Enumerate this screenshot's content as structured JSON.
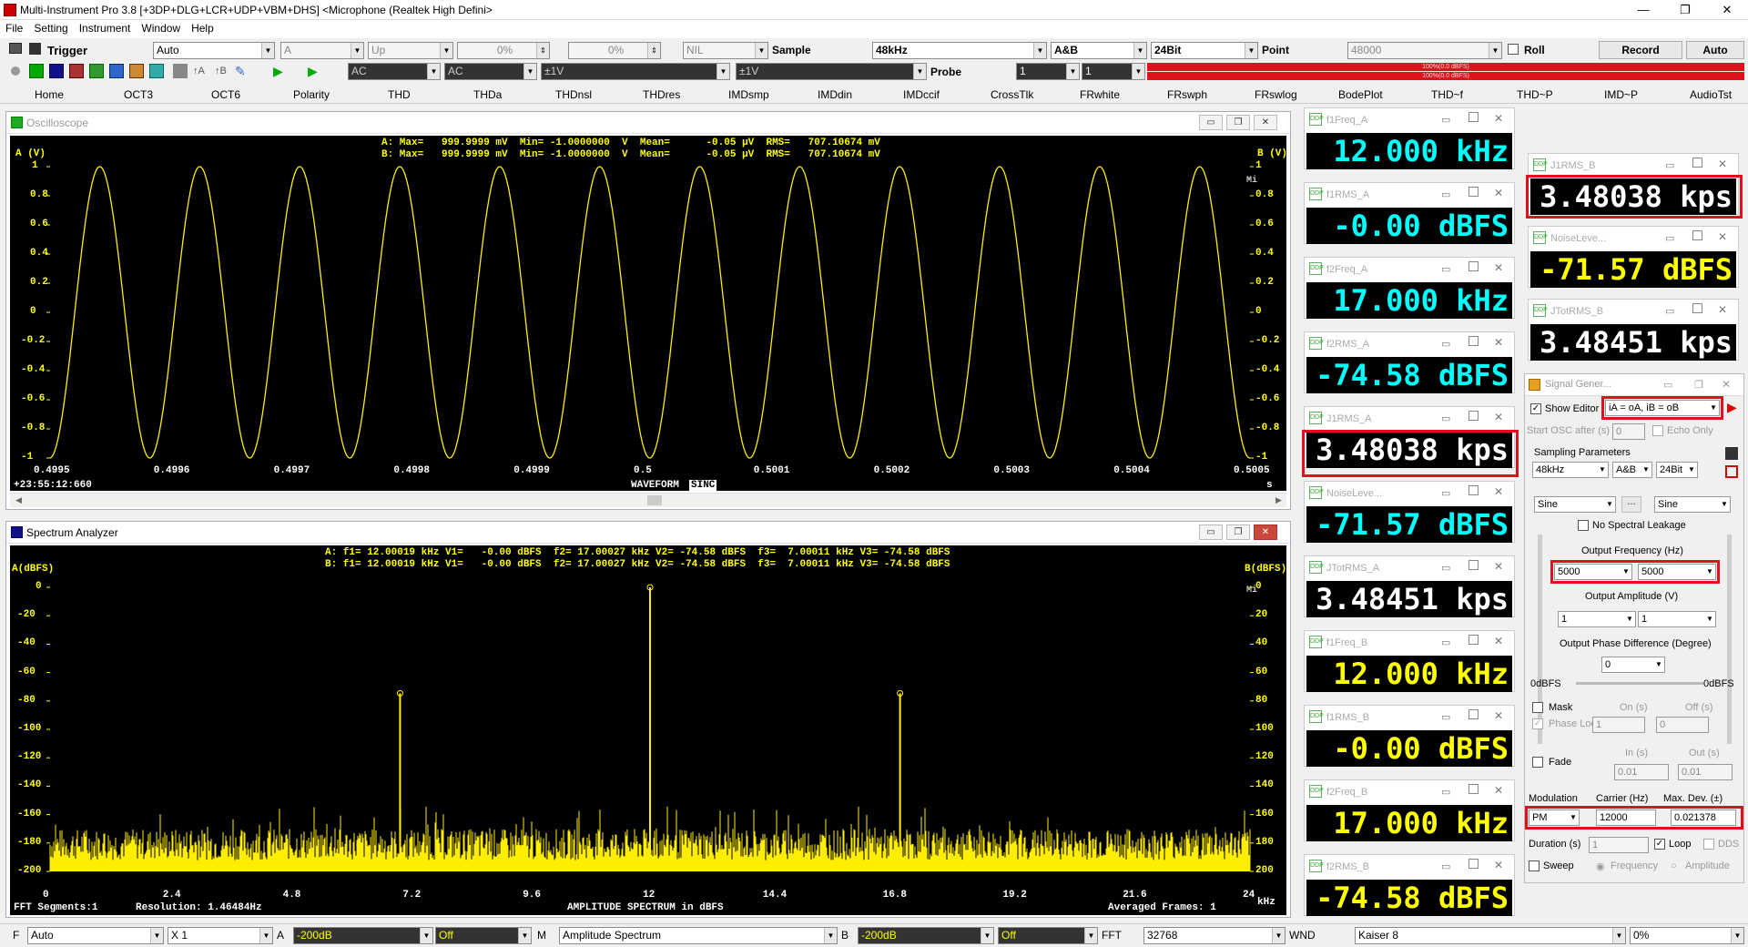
{
  "window": {
    "title": "Multi-Instrument Pro 3.8    [+3DP+DLG+LCR+UDP+VBM+DHS]    <Microphone (Realtek High Defini>",
    "minimize": "—",
    "maximize": "❐",
    "close": "✕"
  },
  "menu": [
    "File",
    "Setting",
    "Instrument",
    "Window",
    "Help"
  ],
  "toolbar1": {
    "trigger_label": "Trigger",
    "trigger_mode": "Auto",
    "channel": "A",
    "slope": "Up",
    "level1": "0%",
    "level2": "0%",
    "nil": "NIL",
    "sample_label": "Sample",
    "sample_rate": "48kHz",
    "channels": "A&B",
    "bits": "24Bit",
    "point_label": "Point",
    "points": "48000",
    "roll_label": "Roll",
    "record_label": "Record",
    "auto_label": "Auto"
  },
  "toolbar2": {
    "coupling_a": "AC",
    "coupling_b": "AC",
    "range_a": "±1V",
    "range_b": "±1V",
    "probe_label": "Probe",
    "probe_a": "1",
    "probe_b": "1",
    "level_meter_text": "100%(0.0 dBFS)"
  },
  "tabs": [
    "Home",
    "OCT3",
    "OCT6",
    "Polarity",
    "THD",
    "THDa",
    "THDnsl",
    "THDres",
    "IMDsmp",
    "IMDdin",
    "IMDccif",
    "CrossTlk",
    "FRwhite",
    "FRswph",
    "FRswlog",
    "BodePlot",
    "THD~f",
    "THD~P",
    "IMD~P",
    "AudioTst"
  ],
  "oscilloscope": {
    "title": "Oscilloscope",
    "info_a": "A: Max=   999.9999 mV  Min= -1.0000000  V  Mean=      -0.05 µV  RMS=   707.10674 mV",
    "info_b": "B: Max=   999.9999 mV  Min= -1.0000000  V  Mean=      -0.05 µV  RMS=   707.10674 mV",
    "ylabel_a": "A (V)",
    "ylabel_b": "B (V)",
    "yticks_left": [
      "1",
      "0.8",
      "0.6",
      "0.4",
      "0.2",
      "0",
      "-0.2",
      "-0.4",
      "-0.6",
      "-0.8",
      "-1"
    ],
    "yticks_right": [
      "1",
      "0.8",
      "0.6",
      "0.4",
      "0.2",
      "0",
      "-0.2",
      "-0.4",
      "-0.6",
      "-0.8",
      "-1"
    ],
    "xticks": [
      "0.4995",
      "0.4996",
      "0.4997",
      "0.4998",
      "0.4999",
      "0.5",
      "0.5001",
      "0.5002",
      "0.5003",
      "0.5004",
      "0.5005"
    ],
    "xunit": "s",
    "timestamp": "+23:55:12:660",
    "footer": "WAVEFORM",
    "footer2": "SINC",
    "badge": "Mi"
  },
  "spectrum": {
    "title": "Spectrum Analyzer",
    "info_a": "A: f1= 12.00019 kHz V1=   -0.00 dBFS  f2= 17.00027 kHz V2= -74.58 dBFS  f3=  7.00011 kHz V3= -74.58 dBFS",
    "info_b": "B: f1= 12.00019 kHz V1=   -0.00 dBFS  f2= 17.00027 kHz V2= -74.58 dBFS  f3=  7.00011 kHz V3= -74.58 dBFS",
    "ylabel_a": "A(dBFS)",
    "ylabel_b": "B(dBFS)",
    "yticks_left": [
      "0",
      "-20",
      "-40",
      "-60",
      "-80",
      "-100",
      "-120",
      "-140",
      "-160",
      "-180",
      "-200"
    ],
    "yticks_right": [
      "0",
      "20",
      "40",
      "60",
      "80",
      "100",
      "120",
      "140",
      "160",
      "180",
      "200"
    ],
    "xticks": [
      "0",
      "2.4",
      "4.8",
      "7.2",
      "9.6",
      "12",
      "14.4",
      "16.8",
      "19.2",
      "21.6",
      "24"
    ],
    "xunit": "kHz",
    "fft_segments": "FFT Segments:1",
    "resolution": "Resolution: 1.46484Hz",
    "footer": "AMPLITUDE SPECTRUM in dBFS",
    "averaged": "Averaged Frames: 1",
    "badge": "Mi"
  },
  "chart_data": [
    {
      "type": "line",
      "title": "Oscilloscope",
      "xlabel": "s",
      "ylabel": "A (V)",
      "xlim": [
        0.4995,
        0.5005
      ],
      "ylim": [
        -1,
        1
      ],
      "grid": false,
      "series": [
        {
          "name": "A",
          "frequency_hz": 12000,
          "amplitude": 1,
          "values_shown": "sine, 12 cycles over 1 ms"
        }
      ]
    },
    {
      "type": "line",
      "title": "Spectrum Analyzer",
      "xlabel": "kHz",
      "ylabel": "A(dBFS)",
      "xlim": [
        0,
        24
      ],
      "ylim": [
        -200,
        0
      ],
      "grid": false,
      "series": [
        {
          "name": "A",
          "x": [
            7.00011,
            12.00019,
            17.00027
          ],
          "values": [
            -74.58,
            0,
            -74.58
          ]
        }
      ]
    }
  ],
  "meters_left": [
    {
      "title": "f1Freq_A",
      "value": "12.000 kHz",
      "color": "cy"
    },
    {
      "title": "f1RMS_A",
      "value": "-0.00 dBFS",
      "color": "cy"
    },
    {
      "title": "f2Freq_A",
      "value": "17.000 kHz",
      "color": "cy"
    },
    {
      "title": "f2RMS_A",
      "value": "-74.58 dBFS",
      "color": "cy"
    },
    {
      "title": "J1RMS_A",
      "value": "3.48038 kps",
      "color": "wh"
    },
    {
      "title": "NoiseLeve...",
      "value": "-71.57 dBFS",
      "color": "cy"
    },
    {
      "title": "JTotRMS_A",
      "value": "3.48451 kps",
      "color": "wh"
    },
    {
      "title": "f1Freq_B",
      "value": "12.000 kHz",
      "color": "yw"
    },
    {
      "title": "f1RMS_B",
      "value": "-0.00 dBFS",
      "color": "yw"
    },
    {
      "title": "f2Freq_B",
      "value": "17.000 kHz",
      "color": "yw"
    },
    {
      "title": "f2RMS_B",
      "value": "-74.58 dBFS",
      "color": "yw"
    }
  ],
  "meters_right": [
    {
      "title": "J1RMS_B",
      "value": "3.48038 kps",
      "color": "wh"
    },
    {
      "title": "NoiseLeve...",
      "value": "-71.57 dBFS",
      "color": "yw"
    },
    {
      "title": "JTotRMS_B",
      "value": "3.48451 kps",
      "color": "wh"
    }
  ],
  "siggen": {
    "title": "Signal Gener...",
    "show_editor": "Show Editor",
    "editor_mode": "iA = oA, iB = oB",
    "start_osc": "Start OSC after (s)",
    "start_osc_val": "0",
    "echo_only": "Echo Only",
    "sampling_params": "Sampling Parameters",
    "rate": "48kHz",
    "ch": "A&B",
    "bits": "24Bit",
    "wave_a": "Sine",
    "wave_b": "Sine",
    "no_leak": "No Spectral Leakage",
    "out_freq_label": "Output Frequency (Hz)",
    "freq_a": "5000",
    "freq_b": "5000",
    "out_amp_label": "Output Amplitude (V)",
    "amp_a": "1",
    "amp_b": "1",
    "phase_label": "Output Phase Difference (Degree)",
    "phase": "0",
    "dbfs_left": "0dBFS",
    "dbfs_right": "0dBFS",
    "mask": "Mask",
    "phase_lock": "Phase Lock",
    "on_s": "On (s)",
    "off_s": "Off (s)",
    "on_val": "1",
    "off_val": "0",
    "fade": "Fade",
    "in_s": "In (s)",
    "out_s": "Out (s)",
    "in_val": "0.01",
    "out_val": "0.01",
    "modulation": "Modulation",
    "carrier": "Carrier (Hz)",
    "maxdev": "Max. Dev. (±)",
    "mod_type": "PM",
    "carrier_val": "12000",
    "maxdev_val": "0.021378",
    "duration": "Duration (s)",
    "duration_val": "1",
    "loop": "Loop",
    "dds": "DDS",
    "sweep": "Sweep",
    "frequency": "Frequency",
    "amplitude": "Amplitude"
  },
  "statusbar": {
    "f_label": "F",
    "f_mode": "Auto",
    "x_label": "X 1",
    "a_label": "A",
    "a_range": "-200dB",
    "a_off": "Off",
    "m_label": "M",
    "m_mode": "Amplitude Spectrum",
    "b_label": "B",
    "b_range": "-200dB",
    "b_off": "Off",
    "fft_label": "FFT",
    "fft_size": "32768",
    "wnd_label": "WND",
    "window": "Kaiser 8",
    "overlap": "0%"
  }
}
